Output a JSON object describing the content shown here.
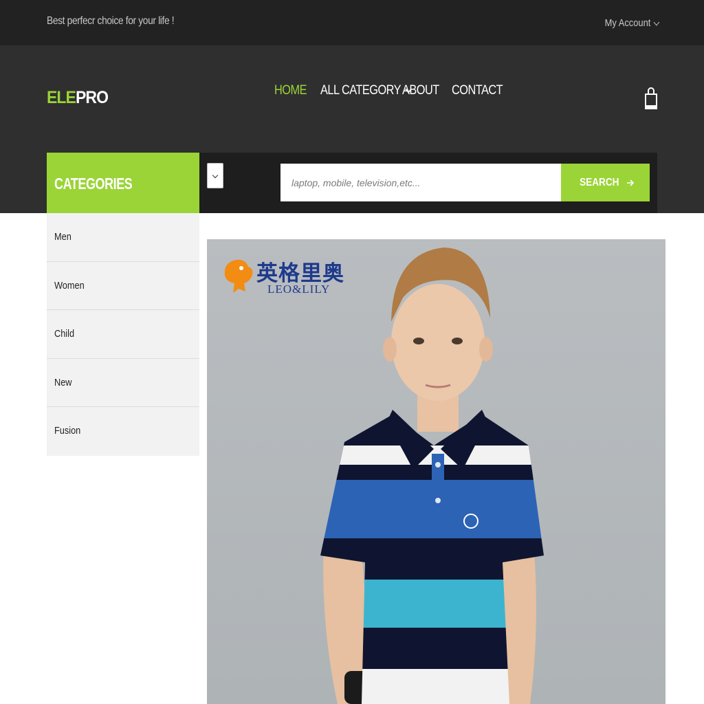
{
  "topbar": {
    "tagline": "Best perfecr choice for your life !",
    "account_label": "My Account"
  },
  "header": {
    "logo_part1": "ELE",
    "logo_part2": "PRO",
    "nav": [
      {
        "label": "HOME",
        "active": true
      },
      {
        "label": "ALL CATEGORY",
        "dropdown": true
      },
      {
        "label": "ABOUT"
      },
      {
        "label": "CONTACT"
      }
    ],
    "cart_icon": "shopping-bag-icon"
  },
  "categories": {
    "title": "CATEGORIES",
    "items": [
      "Men",
      "Women",
      "Child",
      "New",
      "Fusion"
    ]
  },
  "search": {
    "placeholder": "laptop, mobile, television,etc...",
    "button_label": "SEARCH",
    "button_icon": "arrow-right-icon",
    "category_select_icon": "chevron-down-icon"
  },
  "banner": {
    "brand_cn": "英格里奥",
    "brand_en": "LEO&LILY",
    "brand_icon": "lion-logo-icon"
  },
  "colors": {
    "accent": "#9bd437",
    "topbar_bg": "#222222",
    "header_bg": "#2f2f2f",
    "search_strip_bg": "#1e1e1e",
    "brand_blue": "#1e3a8c"
  }
}
